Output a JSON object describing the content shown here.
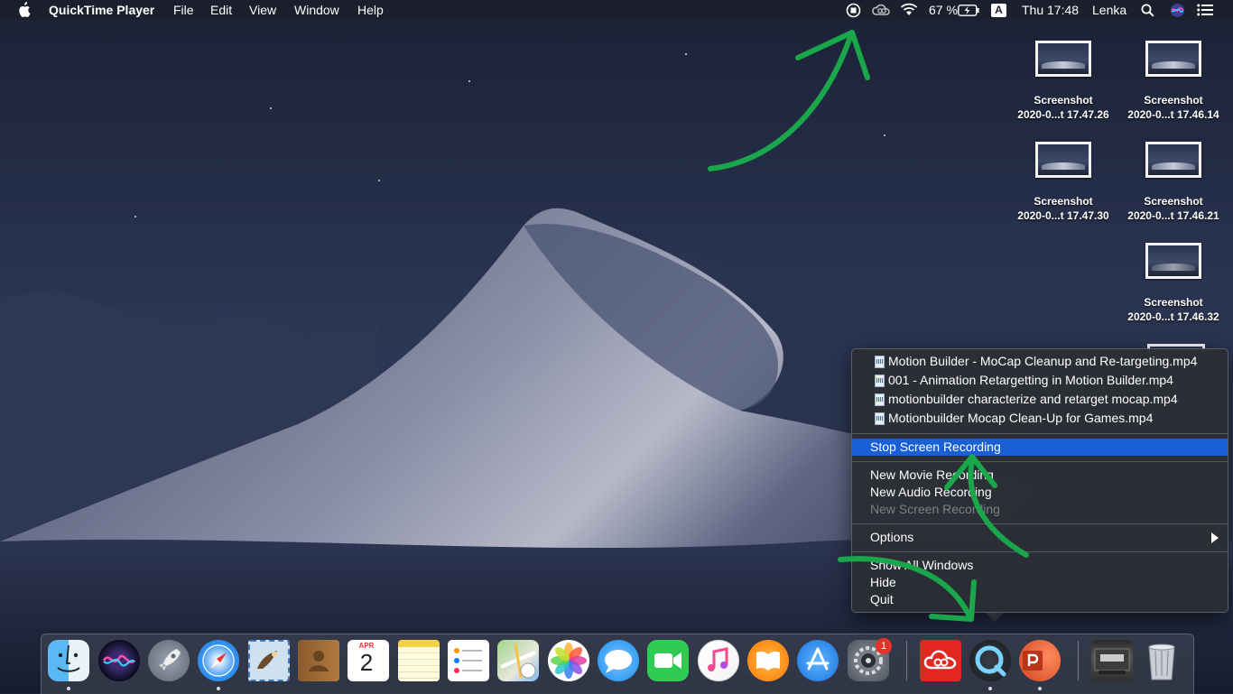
{
  "menubar": {
    "app_name": "QuickTime Player",
    "menus": [
      "File",
      "Edit",
      "View",
      "Window",
      "Help"
    ],
    "battery": "67 %",
    "input_source": "A",
    "clock": "Thu 17:48",
    "user": "Lenka"
  },
  "desktop_icons": [
    {
      "line1": "Screenshot",
      "line2": "2020-0...t 17.47.26"
    },
    {
      "line1": "Screenshot",
      "line2": "2020-0...t 17.46.14"
    },
    {
      "line1": "Screenshot",
      "line2": "2020-0...t 17.47.30"
    },
    {
      "line1": "Screenshot",
      "line2": "2020-0...t 17.46.21"
    },
    {
      "line1": "Screenshot",
      "line2": "2020-0...t 17.46.32"
    }
  ],
  "context_menu": {
    "recent_files": [
      "Motion Builder - MoCap Cleanup and Re-targeting.mp4",
      "001 -  Animation Retargetting in Motion Builder.mp4",
      "motionbuilder characterize and retarget mocap.mp4",
      "Motionbuilder Mocap Clean-Up for Games.mp4"
    ],
    "stop_recording": "Stop Screen Recording",
    "new_movie": "New Movie Recording",
    "new_audio": "New Audio Recording",
    "new_screen": "New Screen Recording",
    "options": "Options",
    "show_all": "Show All Windows",
    "hide": "Hide",
    "quit": "Quit"
  },
  "dock": {
    "calendar_month": "APR",
    "calendar_day": "2",
    "appstore_badge": "1",
    "apps": [
      "finder-icon",
      "siri-icon",
      "launchpad-icon",
      "safari-icon",
      "mail-icon",
      "contacts-icon",
      "calendar-icon",
      "notes-icon",
      "reminders-icon",
      "maps-icon",
      "photos-icon",
      "messages-icon",
      "facetime-icon",
      "itunes-icon",
      "books-icon",
      "app-store-icon",
      "system-preferences-icon",
      "creative-cloud-icon",
      "quicktime-icon",
      "powerpoint-icon",
      "downloads-stack-icon",
      "trash-icon"
    ]
  },
  "colors": {
    "highlight": "#1a5fd4",
    "annotation_arrow": "#1aa64a"
  }
}
